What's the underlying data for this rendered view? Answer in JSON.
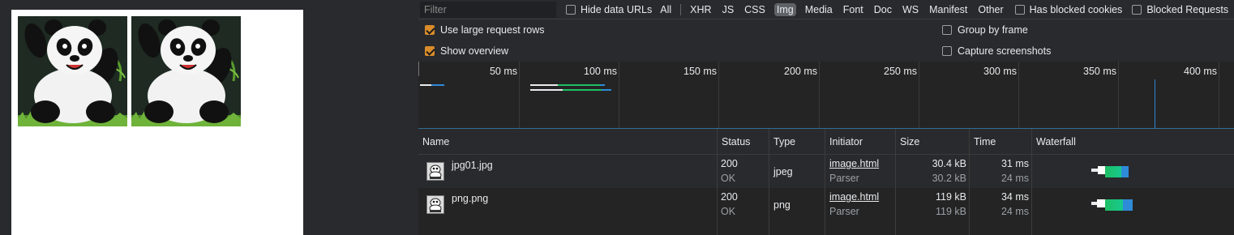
{
  "devtools": {
    "filter_placeholder": "Filter",
    "toolbar": {
      "hide_data_urls": {
        "label": "Hide data URLs",
        "checked": false
      },
      "types": [
        "All",
        "XHR",
        "JS",
        "CSS",
        "Img",
        "Media",
        "Font",
        "Doc",
        "WS",
        "Manifest",
        "Other"
      ],
      "active_type": "Img",
      "has_blocked_cookies": {
        "label": "Has blocked cookies",
        "checked": false
      },
      "blocked_requests": {
        "label": "Blocked Requests",
        "checked": false
      }
    },
    "options": {
      "large_rows": {
        "label": "Use large request rows",
        "checked": true
      },
      "show_overview": {
        "label": "Show overview",
        "checked": true
      },
      "group_by_frame": {
        "label": "Group by frame",
        "checked": false
      },
      "capture_screenshots": {
        "label": "Capture screenshots",
        "checked": false
      }
    },
    "overview": {
      "ticks": [
        "50 ms",
        "100 ms",
        "150 ms",
        "200 ms",
        "250 ms",
        "300 ms",
        "350 ms",
        "400 ms"
      ]
    },
    "table": {
      "columns": [
        "Name",
        "Status",
        "Type",
        "Initiator",
        "Size",
        "Time",
        "Waterfall"
      ],
      "rows": [
        {
          "name": "jpg01.jpg",
          "status": "200",
          "status_text": "OK",
          "type": "jpeg",
          "initiator": "image.html",
          "initiator_sub": "Parser",
          "size": "30.4 kB",
          "size_sub": "30.2 kB",
          "time": "31 ms",
          "time_sub": "24 ms"
        },
        {
          "name": "png.png",
          "status": "200",
          "status_text": "OK",
          "type": "png",
          "initiator": "image.html",
          "initiator_sub": "Parser",
          "size": "119 kB",
          "size_sub": "119 kB",
          "time": "34 ms",
          "time_sub": "24 ms"
        }
      ]
    }
  },
  "colors": {
    "checkbox_checked": "#d98c2b",
    "waterfall_green": "#1fbf63",
    "waterfall_blue": "#2e8bd8",
    "active_filter": "#5f6368"
  }
}
